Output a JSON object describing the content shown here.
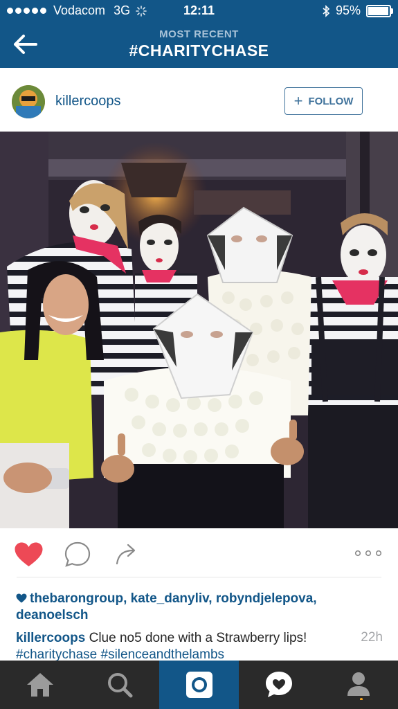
{
  "status_bar": {
    "carrier": "Vodacom",
    "network": "3G",
    "time": "12:11",
    "battery": "95%"
  },
  "header": {
    "subtitle": "MOST RECENT",
    "title": "#CHARITYCHASE"
  },
  "post": {
    "username": "killercoops",
    "follow_label": "FOLLOW",
    "liked_by": "thebarongroup, kate_danyliv, robyndjelepova, deanoelsch",
    "caption_user": "killercoops",
    "caption_text": "Clue no5 done with a Strawberry lips!",
    "caption_tag1": "#charitychase",
    "caption_tag2": "#silenceandthelambs",
    "time_ago": "22h",
    "liked": true
  },
  "tabbar": {
    "active": "camera"
  },
  "colors": {
    "brand": "#125688",
    "like": "#ed4956",
    "tabbar": "#2a2a2a"
  }
}
